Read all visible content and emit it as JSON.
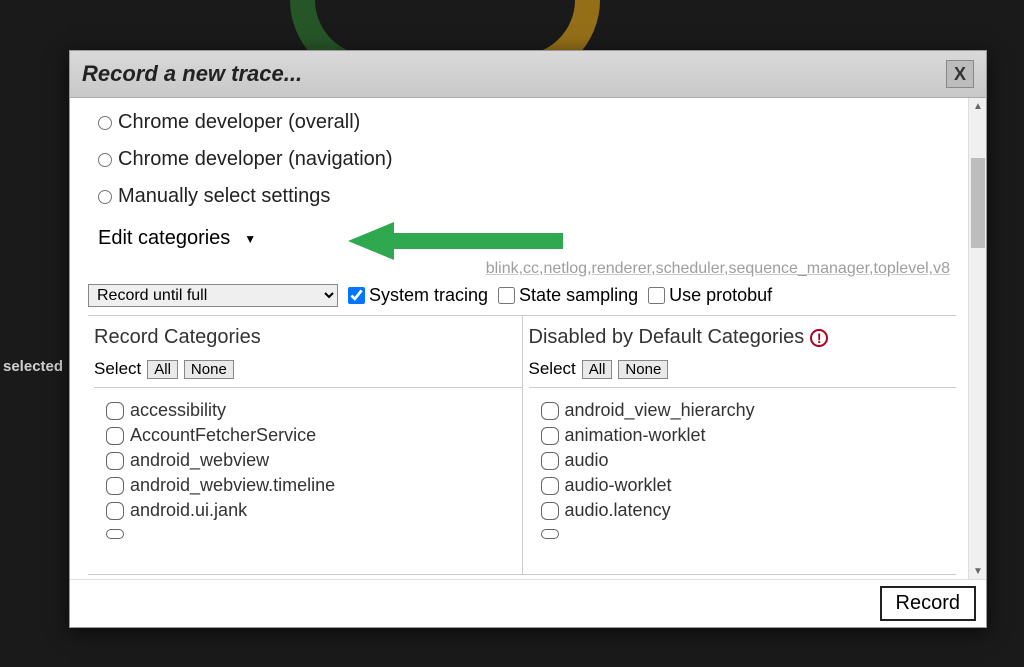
{
  "sideLabel": "selected",
  "dialog": {
    "title": "Record a new trace...",
    "closeGlyph": "X",
    "options": {
      "radio1": "Chrome developer (overall)",
      "radio2": "Chrome developer (navigation)",
      "radio3": "Manually select settings"
    },
    "editCategoriesLabel": "Edit categories",
    "categoriesPath": "blink,cc,netlog,renderer,scheduler,sequence_manager,toplevel,v8",
    "recordMode": {
      "selected": "Record until full"
    },
    "checkboxes": {
      "systemTracing": "System tracing",
      "stateSampling": "State sampling",
      "useProtobuf": "Use protobuf"
    },
    "leftCol": {
      "title": "Record Categories",
      "selectLabel": "Select",
      "allBtn": "All",
      "noneBtn": "None",
      "items": [
        "accessibility",
        "AccountFetcherService",
        "android_webview",
        "android_webview.timeline",
        "android.ui.jank"
      ]
    },
    "rightCol": {
      "title": "Disabled by Default Categories",
      "selectLabel": "Select",
      "allBtn": "All",
      "noneBtn": "None",
      "items": [
        "android_view_hierarchy",
        "animation-worklet",
        "audio",
        "audio-worklet",
        "audio.latency"
      ]
    },
    "recordBtn": "Record"
  },
  "annotation": {
    "arrowColor": "#2fa84f"
  }
}
